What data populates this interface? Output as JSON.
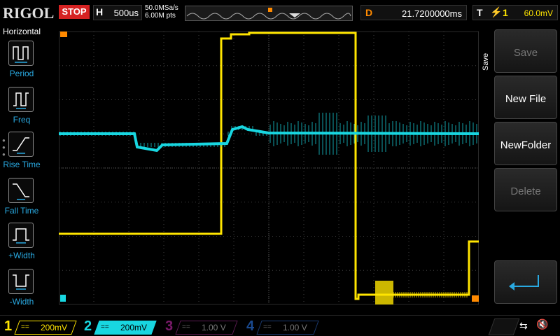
{
  "topbar": {
    "brand": "RIGOL",
    "run_state": "STOP",
    "horizontal_label": "H",
    "timebase": "500us",
    "sample_rate": "50.0MSa/s",
    "memory_depth": "6.00M pts",
    "delay_label": "D",
    "delay_value": "21.7200000ms",
    "trigger_label": "T",
    "trigger_channel": "1",
    "trigger_level": "60.0mV"
  },
  "left_panel": {
    "title": "Horizontal",
    "items": [
      {
        "label": "Period",
        "icon": "period-icon"
      },
      {
        "label": "Freq",
        "icon": "freq-icon"
      },
      {
        "label": "Rise Time",
        "icon": "rise-time-icon"
      },
      {
        "label": "Fall Time",
        "icon": "fall-time-icon"
      },
      {
        "label": "+Width",
        "icon": "pos-width-icon"
      },
      {
        "label": "-Width",
        "icon": "neg-width-icon"
      }
    ]
  },
  "right_panel": {
    "tab_label": "Save",
    "buttons": [
      {
        "label": "Save",
        "enabled": false
      },
      {
        "label": "New File",
        "enabled": true
      },
      {
        "label": "NewFolder",
        "enabled": true
      },
      {
        "label": "Delete",
        "enabled": false
      }
    ],
    "back_icon": "return-arrow-icon"
  },
  "channels": [
    {
      "number": "1",
      "coupling": "==",
      "scale": "200mV",
      "color": "#ffe500",
      "active": true
    },
    {
      "number": "2",
      "coupling": "==",
      "scale": "200mV",
      "color": "#18d6e0",
      "active": true
    },
    {
      "number": "3",
      "coupling": "==",
      "scale": "1.00 V",
      "color": "#c01aa8",
      "active": false
    },
    {
      "number": "4",
      "coupling": "==",
      "scale": "1.00 V",
      "color": "#1a5ec0",
      "active": false
    }
  ],
  "colors": {
    "ch1": "#ffe500",
    "ch2": "#18d6e0",
    "grid": "#555555",
    "accent": "#29a9e1",
    "stop": "#d62222",
    "trigger": "#ff8a00"
  },
  "status_icons": [
    "usb-icon",
    "sound-muted-icon"
  ]
}
